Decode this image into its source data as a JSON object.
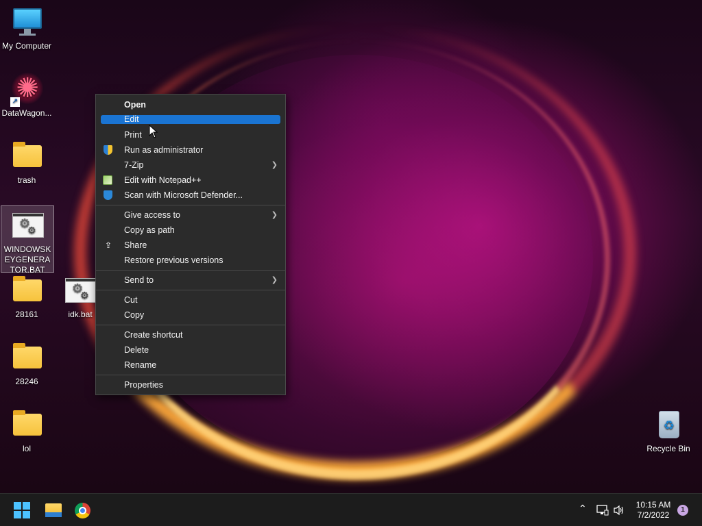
{
  "desktop": {
    "icons": [
      {
        "label": "My Computer"
      },
      {
        "label": "DataWagon..."
      },
      {
        "label": "trash"
      },
      {
        "label": "WINDOWSKEYGENERATOR.BAT"
      },
      {
        "label": "28161"
      },
      {
        "label": "idk.bat"
      },
      {
        "label": "28246"
      },
      {
        "label": "lol"
      },
      {
        "label": "Recycle Bin"
      }
    ]
  },
  "context_menu": {
    "items": [
      {
        "label": "Open"
      },
      {
        "label": "Edit"
      },
      {
        "label": "Print"
      },
      {
        "label": "Run as administrator"
      },
      {
        "label": "7-Zip"
      },
      {
        "label": "Edit with Notepad++"
      },
      {
        "label": "Scan with Microsoft Defender..."
      },
      {
        "label": "Give access to"
      },
      {
        "label": "Copy as path"
      },
      {
        "label": "Share"
      },
      {
        "label": "Restore previous versions"
      },
      {
        "label": "Send to"
      },
      {
        "label": "Cut"
      },
      {
        "label": "Copy"
      },
      {
        "label": "Create shortcut"
      },
      {
        "label": "Delete"
      },
      {
        "label": "Rename"
      },
      {
        "label": "Properties"
      }
    ],
    "highlight_color": "#1a74d2"
  },
  "taskbar": {
    "time": "10:15 AM",
    "date": "7/2/2022",
    "notification_count": "1",
    "accent": "#4cc2ff"
  }
}
